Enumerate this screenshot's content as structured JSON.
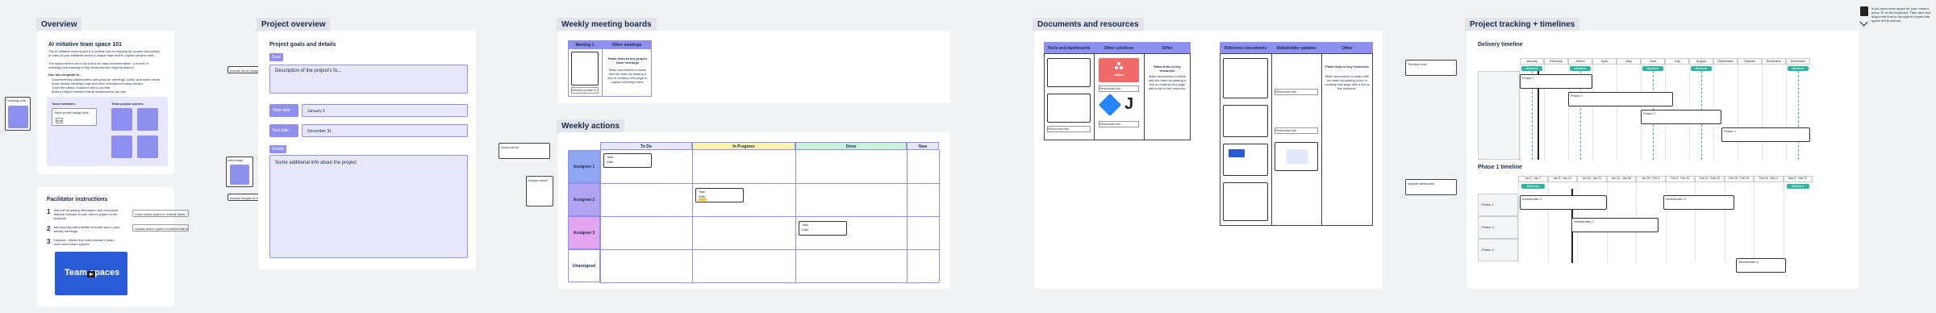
{
  "sections": {
    "overview": "Overview",
    "project_overview": "Project overview",
    "weekly_meeting_boards": "Weekly meeting boards",
    "weekly_actions": "Weekly actions",
    "documents": "Documents and resources",
    "tracking": "Project tracking + timelines"
  },
  "overview": {
    "title": "AI initiative team space 101",
    "intro": "The AI initiative team space is a central hub for tracking all content and activity of ones of your initiatives about a unique topic and to capture project roles.",
    "intro2": "The space serves as a hub that is for easy documentation, a record of meetings and tracking of key decisions and ongoing actions.",
    "use_label": "Use this template to...",
    "bullets": [
      "Document key stakeholders and goals for meetings, notes, and action items",
      "Keep weekly meeting notes and other relevant info easy access",
      "Track the status of actions and to-do lists",
      "Build a project timeline that all stakeholders can see"
    ],
    "team_members": "Team members",
    "team_profile": "Team profile image here",
    "add": "Add",
    "project_owners": "Team project owners"
  },
  "facilitator": {
    "title": "Facilitator instructions",
    "steps": [
      {
        "n": "1",
        "text": "Start off by adding information and resources that are relevant to your team's project in the template."
      },
      {
        "n": "2",
        "text": "Add key important details of tracks and in your weekly meetings."
      },
      {
        "n": "3",
        "text": "Optional - Watch this video tutorial to learn more about team spaces."
      }
    ],
    "button1": "Learn about space in context menu",
    "button2": "Update action space in context menu",
    "video_title": "Team spaces"
  },
  "sidebar_notes": {
    "left_label": "Tracking note",
    "project_label": "Include some images of the teamwork here",
    "left2": "Add image",
    "proj_img_label": "Include images of the teamwork",
    "wa_left": "Action items",
    "wa_left2": "Assign owner"
  },
  "project": {
    "goals_title": "Project goals and details",
    "goal_tag": "Goal",
    "goal_text": "Description of the project's fo...",
    "start_label": "Start date",
    "start_value": "January 1",
    "end_label": "End date",
    "end_value": "December 31",
    "details_tag": "Details",
    "details_text": "Some additional info about the project"
  },
  "meeting_boards": {
    "col1": "Meeting 1",
    "col2": "Other meetings",
    "card_title": "Paste links to key project team meetings",
    "card_text": "Make documents to share with the team by pasting a link or creating new page to capture meeting notes.",
    "link": "Weekly update in context"
  },
  "weekly_actions": {
    "cols": [
      "To Do",
      "In Progress",
      "Done",
      "New"
    ],
    "rows": [
      "Assignee 1",
      "Assignee 2",
      "Assignee 3",
      "Unassigned"
    ],
    "card_label": "Task",
    "card_meta": "Date",
    "col_colors": [
      "#e8e8fd",
      "#fdf3a6",
      "#c9f3d2",
      "#e8e8fd"
    ],
    "row_colors": [
      "#8fa6f2",
      "#b0a4f2",
      "#e3a4f0",
      "#ffffff"
    ]
  },
  "documents": {
    "left": {
      "cols": [
        "Tools and dashboards",
        "Other solutions",
        "Other"
      ]
    },
    "right": {
      "cols": [
        "Reference documents",
        "Stakeholder updates",
        "Other"
      ]
    },
    "card_title": "Paste links to key resources",
    "card_text": "Make documents to share with the team by pasting a link or creating new page with a link to the resource.",
    "asana": "asana",
    "j": "J",
    "link_text": "Resources link"
  },
  "tracking": {
    "delivery_title": "Delivery timeline",
    "phase_title": "Phase 1 timeline",
    "months": [
      "January",
      "February",
      "March",
      "April",
      "May",
      "June",
      "July",
      "August",
      "September",
      "October",
      "November",
      "December"
    ],
    "bars": [
      "Phase 1",
      "Phase 2",
      "Phase 3",
      "Phase 4"
    ],
    "weeks": [
      "Jan 1 - Jan 7",
      "Jan 8 - Jan 14",
      "Jan 15 - Jan 21",
      "Jan 22 - Jan 28",
      "Jan 29 - Feb 4",
      "Feb 5 - Feb 11",
      "Feb 12 - Feb 18",
      "Feb 19 - Feb 25",
      "Feb 26 - Mar 4",
      "Mar 5 - Mar 11"
    ],
    "phase_rows": [
      "Phase 1",
      "Phase 2",
      "Phase 3"
    ],
    "phase_bars": [
      "Workstream 1",
      "Workstream 2",
      "Workstream 3",
      "Workstream 4"
    ],
    "milestone": "Milestone",
    "side_note": "Timeline note",
    "side_note2": "Update milestones"
  },
  "corner_note": "If you need more space for your content, press 'N' on the keyboard. Then click and drag more time to the right to expand the space of the canvas."
}
